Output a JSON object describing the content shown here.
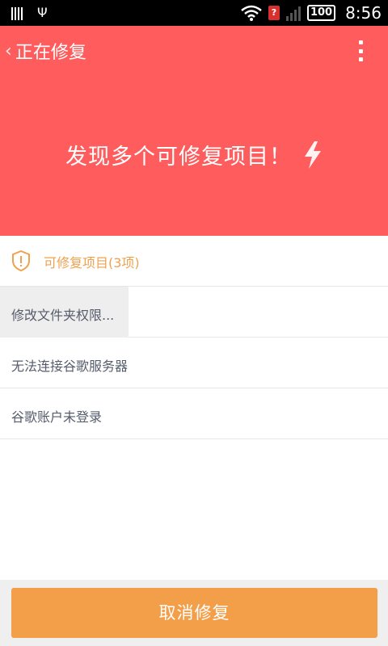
{
  "statusbar": {
    "battery": "100",
    "time": "8:56",
    "alert_glyph": "?",
    "icons": [
      "sim-card-icon",
      "usb-icon",
      "wifi-icon",
      "alert-icon",
      "signal-icon",
      "battery-icon"
    ]
  },
  "header": {
    "back_chevron": "‹",
    "title": "正在修复",
    "menu_icon": "overflow-menu-icon",
    "color": "#ff5d5d"
  },
  "hero": {
    "headline": "发现多个可修复项目！",
    "icon": "lightning-bolt-icon"
  },
  "section": {
    "title": "可修复项目(3项)",
    "icon": "shield-alert-icon",
    "color": "#f0a14e"
  },
  "items": [
    {
      "label": "修改文件夹权限..."
    },
    {
      "label": "无法连接谷歌服务器"
    },
    {
      "label": "谷歌账户未登录"
    }
  ],
  "footer": {
    "cancel_label": "取消修复",
    "button_color": "#f39f4a"
  }
}
